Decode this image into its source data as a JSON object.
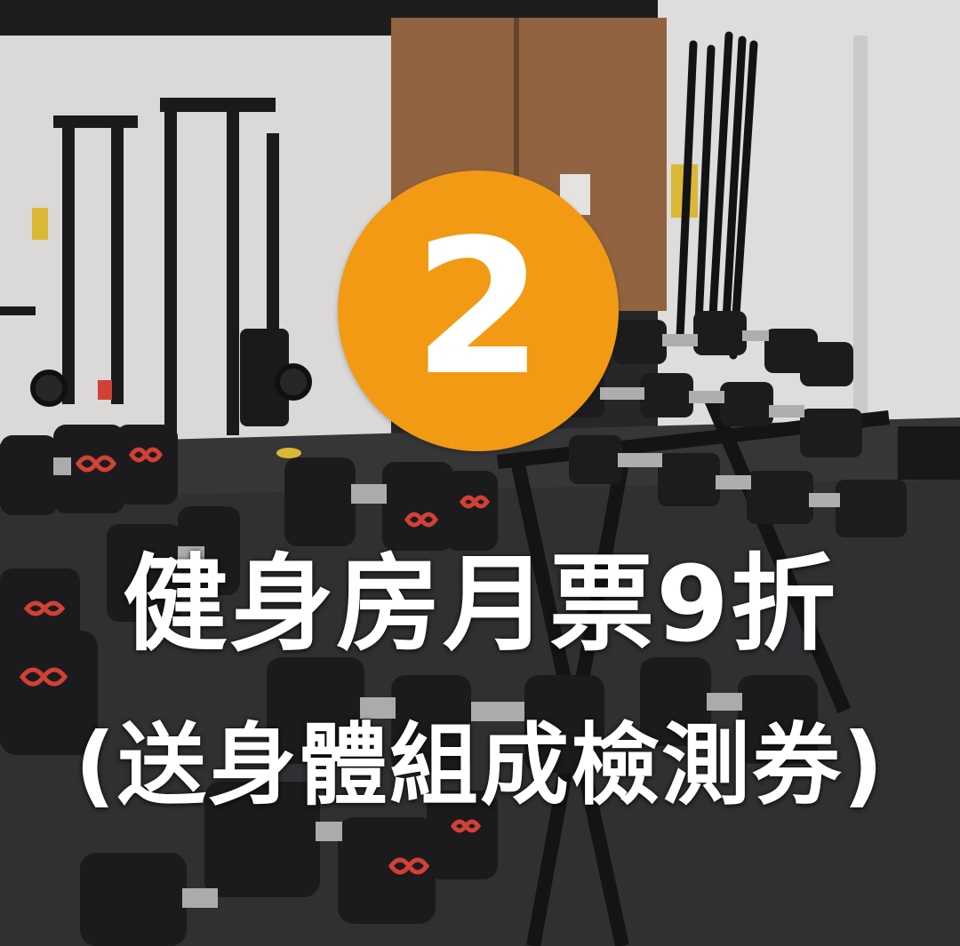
{
  "badge": {
    "number": "2",
    "color": "#F29A13"
  },
  "headline": "健身房月票9折",
  "subline": "(送身體組成檢測券)",
  "photo": {
    "palette": {
      "wall": "#e7e6e4",
      "floor": "#3a3a3d",
      "door": "#9b6a45",
      "equipment": "#1c1c1e",
      "accent_red": "#e0453a"
    }
  }
}
